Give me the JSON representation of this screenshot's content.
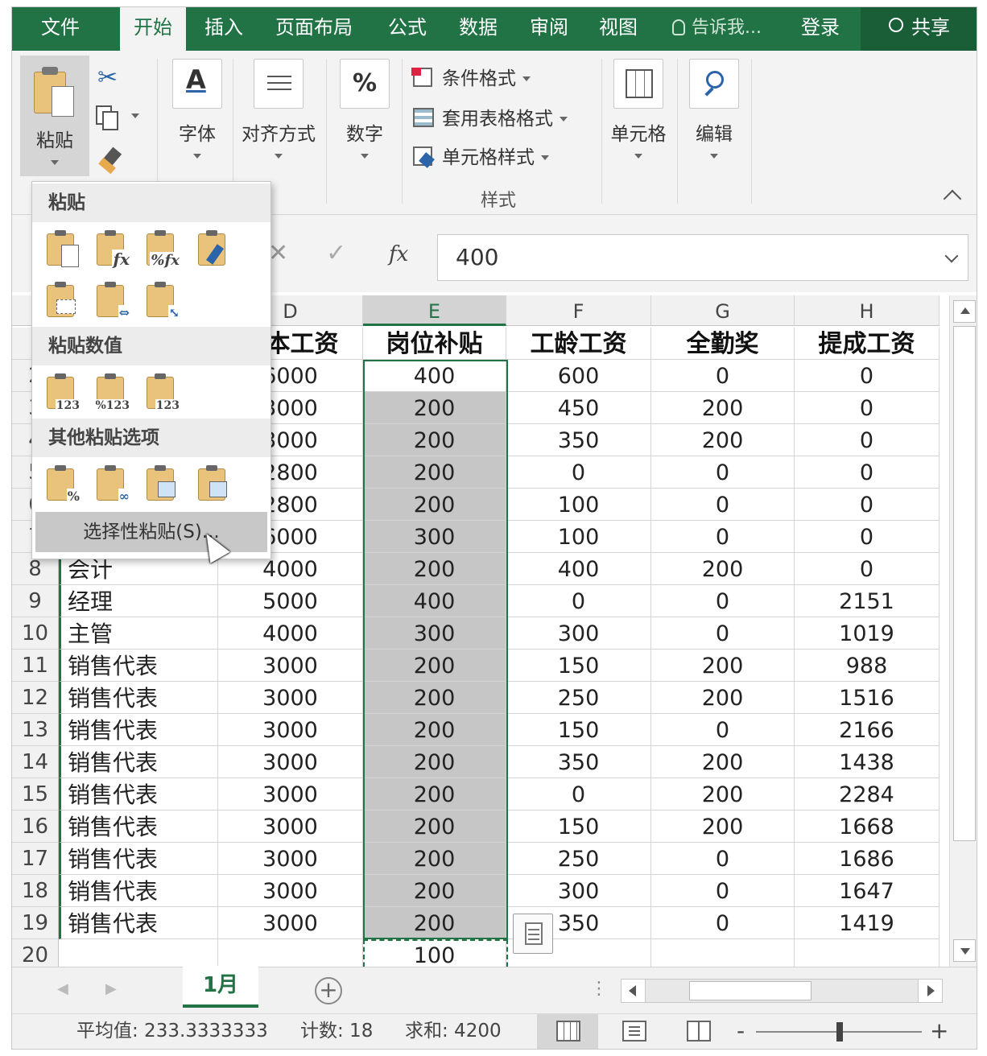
{
  "tabs": [
    "文件",
    "开始",
    "插入",
    "页面布局",
    "公式",
    "数据",
    "审阅",
    "视图"
  ],
  "active_tab": "开始",
  "tell_me": "告诉我...",
  "login": "登录",
  "share": "共享",
  "ribbon": {
    "paste": "粘贴",
    "font": "字体",
    "align": "对齐方式",
    "number": "数字",
    "number_glyph": "%",
    "cond_format": "条件格式",
    "table_format": "套用表格格式",
    "cell_style": "单元格样式",
    "styles_group": "样式",
    "cells": "单元格",
    "edit": "编辑"
  },
  "formula_bar": {
    "fx": "fx",
    "value": "400"
  },
  "columns": [
    {
      "letter": "D",
      "selected": false
    },
    {
      "letter": "E",
      "selected": true
    },
    {
      "letter": "F",
      "selected": false
    },
    {
      "letter": "G",
      "selected": false
    },
    {
      "letter": "H",
      "selected": false
    }
  ],
  "header_row": [
    "基本工资",
    "岗位补贴",
    "工龄工资",
    "全勤奖",
    "提成工资"
  ],
  "rows": [
    {
      "num": "2",
      "b": "",
      "d": "6000",
      "e": "400",
      "f": "600",
      "g": "0",
      "h": "0"
    },
    {
      "num": "3",
      "b": "",
      "d": "3000",
      "e": "200",
      "f": "450",
      "g": "200",
      "h": "0"
    },
    {
      "num": "4",
      "b": "",
      "d": "3000",
      "e": "200",
      "f": "350",
      "g": "200",
      "h": "0"
    },
    {
      "num": "5",
      "b": "",
      "d": "2800",
      "e": "200",
      "f": "0",
      "g": "0",
      "h": "0"
    },
    {
      "num": "6",
      "b": "",
      "d": "2800",
      "e": "200",
      "f": "100",
      "g": "0",
      "h": "0"
    },
    {
      "num": "7",
      "b": "",
      "d": "6000",
      "e": "300",
      "f": "100",
      "g": "0",
      "h": "0"
    },
    {
      "num": "8",
      "b": "会计",
      "d": "4000",
      "e": "200",
      "f": "400",
      "g": "200",
      "h": "0"
    },
    {
      "num": "9",
      "b": "经理",
      "d": "5000",
      "e": "400",
      "f": "0",
      "g": "0",
      "h": "2151"
    },
    {
      "num": "10",
      "b": "主管",
      "d": "4000",
      "e": "300",
      "f": "300",
      "g": "0",
      "h": "1019"
    },
    {
      "num": "11",
      "b": "销售代表",
      "d": "3000",
      "e": "200",
      "f": "150",
      "g": "200",
      "h": "988"
    },
    {
      "num": "12",
      "b": "销售代表",
      "d": "3000",
      "e": "200",
      "f": "250",
      "g": "200",
      "h": "1516"
    },
    {
      "num": "13",
      "b": "销售代表",
      "d": "3000",
      "e": "200",
      "f": "150",
      "g": "0",
      "h": "2166"
    },
    {
      "num": "14",
      "b": "销售代表",
      "d": "3000",
      "e": "200",
      "f": "350",
      "g": "200",
      "h": "1438"
    },
    {
      "num": "15",
      "b": "销售代表",
      "d": "3000",
      "e": "200",
      "f": "0",
      "g": "200",
      "h": "2284"
    },
    {
      "num": "16",
      "b": "销售代表",
      "d": "3000",
      "e": "200",
      "f": "150",
      "g": "200",
      "h": "1668"
    },
    {
      "num": "17",
      "b": "销售代表",
      "d": "3000",
      "e": "200",
      "f": "250",
      "g": "0",
      "h": "1686"
    },
    {
      "num": "18",
      "b": "销售代表",
      "d": "3000",
      "e": "200",
      "f": "300",
      "g": "0",
      "h": "1647"
    },
    {
      "num": "19",
      "b": "销售代表",
      "d": "3000",
      "e": "200",
      "f": "350",
      "g": "0",
      "h": "1419"
    },
    {
      "num": "20",
      "b": "",
      "d": "",
      "e": "100",
      "f": "",
      "g": "",
      "h": ""
    }
  ],
  "paste_menu": {
    "section_paste": "粘贴",
    "section_values": "粘贴数值",
    "section_other": "其他粘贴选项",
    "special": "选择性粘贴(S)..."
  },
  "sheet": {
    "name": "1月",
    "add": "+"
  },
  "status": {
    "average": "平均值: 233.3333333",
    "count": "计数: 18",
    "sum": "求和: 4200",
    "zoom_minus": "-",
    "zoom_plus": "+"
  },
  "colors": {
    "accent": "#217346",
    "selection": "#c6c6c6"
  }
}
